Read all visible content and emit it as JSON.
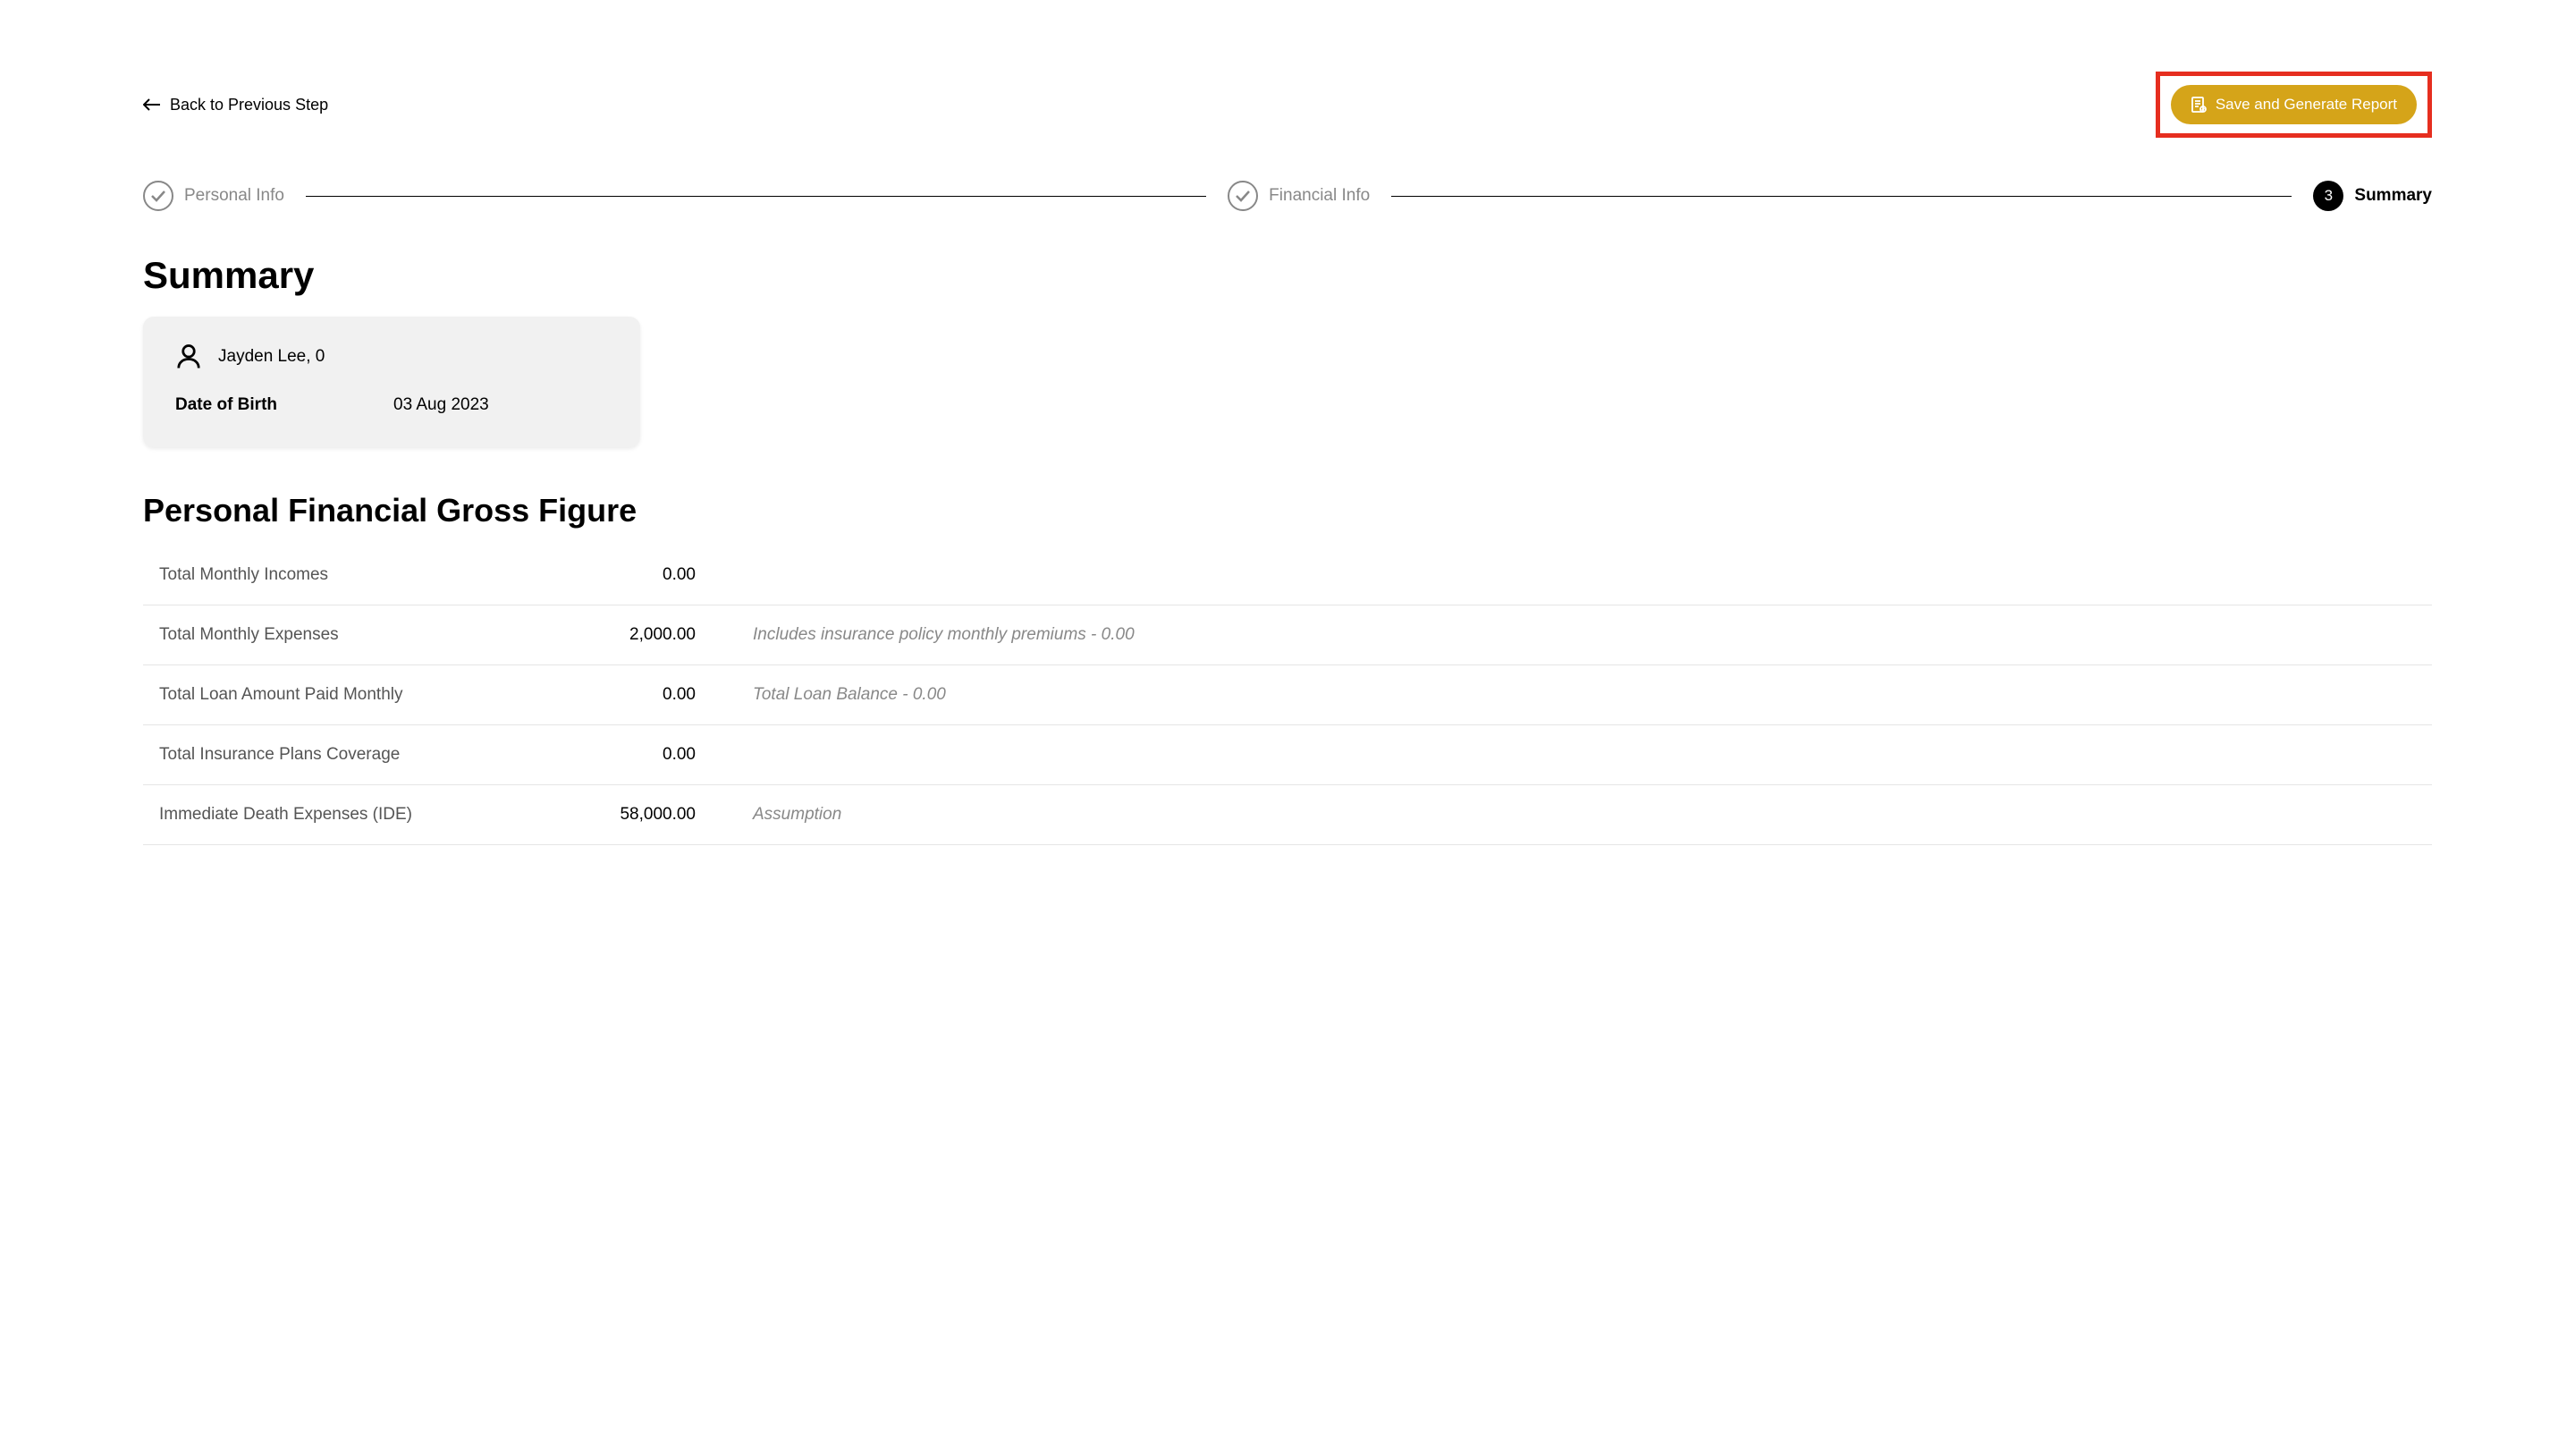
{
  "header": {
    "back_label": "Back to Previous Step",
    "save_label": "Save and Generate Report"
  },
  "stepper": {
    "step1_label": "Personal Info",
    "step2_label": "Financial Info",
    "step3_number": "3",
    "step3_label": "Summary"
  },
  "summary": {
    "title": "Summary",
    "profile": {
      "name_age": "Jayden Lee, 0",
      "dob_label": "Date of Birth",
      "dob_value": "03 Aug 2023"
    }
  },
  "financial": {
    "title": "Personal Financial Gross Figure",
    "rows": [
      {
        "label": "Total Monthly Incomes",
        "value": "0.00",
        "note": ""
      },
      {
        "label": "Total Monthly Expenses",
        "value": "2,000.00",
        "note": "Includes insurance policy monthly premiums - 0.00"
      },
      {
        "label": "Total Loan Amount Paid Monthly",
        "value": "0.00",
        "note": "Total Loan Balance - 0.00"
      },
      {
        "label": "Total Insurance Plans Coverage",
        "value": "0.00",
        "note": ""
      },
      {
        "label": "Immediate Death Expenses (IDE)",
        "value": "58,000.00",
        "note": "Assumption"
      }
    ]
  }
}
